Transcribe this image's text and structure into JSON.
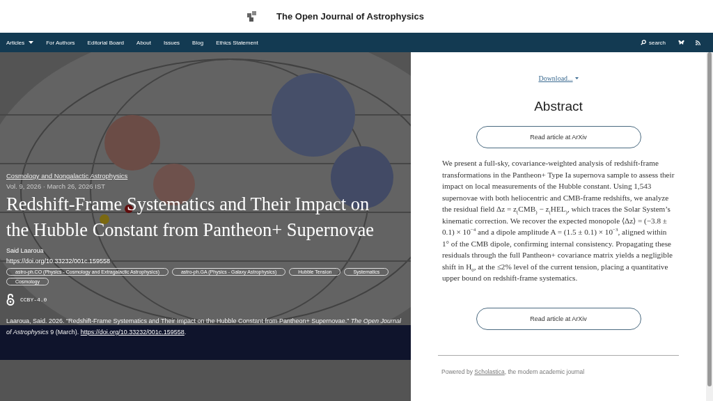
{
  "header": {
    "title": "The Open Journal of Astrophysics"
  },
  "nav": {
    "items": [
      {
        "label": "Articles",
        "dropdown": true
      },
      {
        "label": "For Authors",
        "dropdown": false
      },
      {
        "label": "Editorial Board",
        "dropdown": false
      },
      {
        "label": "About",
        "dropdown": false
      },
      {
        "label": "Issues",
        "dropdown": false
      },
      {
        "label": "Blog",
        "dropdown": false
      },
      {
        "label": "Ethics Statement",
        "dropdown": false
      }
    ],
    "search": "search"
  },
  "article": {
    "category": "Cosmology and Nongalactic Astrophysics",
    "meta": "Vol. 9, 2026 · March 26, 2026 IST",
    "title": "Redshift-Frame Systematics and Their Impact on the Hubble Constant from Pantheon+ Supernovae",
    "author": "Said Laaroua",
    "doi": "https://doi.org/10.33232/001c.159558",
    "tags": [
      "astro-ph.CO (Physics - Cosmology and Extragalactic Astrophysics)",
      "astro-ph.GA (Physics - Galaxy Astrophysics)",
      "Hubble Tension",
      "Systematics",
      "Cosmology"
    ],
    "license": "CCBY-4.0",
    "citation": {
      "text": "Laaroua, Said. 2026. “Redshift-Frame Systematics and Their Impact on the Hubble Constant from Pantheon+ Supernovae.” *The Open Journal of Astrophysics* 9 (March). ",
      "link": "https://doi.org/10.33232/001c.159558",
      "end": "."
    }
  },
  "side": {
    "download": "Download...",
    "heading": "Abstract",
    "buttons": [
      "Read article at ArXiv",
      "Read article at ArXiv"
    ],
    "abstract": "We present a full-sky, covariance-weighted analysis of redshift-frame transformations in the Pantheon+ Type Ia supernova sample to assess their impact on local measurements of the Hubble constant. Using 1,543 supernovae with both heliocentric and CMB-frame redshifts, we analyze the residual field Δz = z$_{(}$CMB$_{)}$ − z$_{(}$HEL$_{)}$, which traces the Solar System’s kinematic correction. We recover the expected monopole ⟨Δz⟩ = (−3.8 ± 0.1) × 10$^{−4}$ and a dipole amplitude A = (1.5 ± 0.1) × 10$^{−3}$, aligned within 1° of the CMB dipole, confirming internal consistency. Propagating these residuals through the full Pantheon+ covariance matrix yields a negligible shift in H$_{0}$, at the ≤2% level of the current tension, placing a quantitative upper bound on redshift-frame systematics.",
    "footer": {
      "before": "Powered by ",
      "link": "Scholastica",
      "after": ", the modern academic journal"
    }
  }
}
